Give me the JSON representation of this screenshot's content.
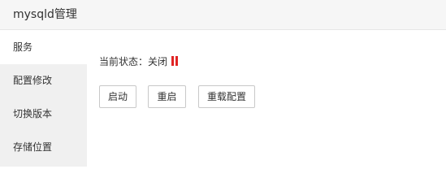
{
  "window": {
    "title": "mysqld管理"
  },
  "sidebar": {
    "items": [
      {
        "label": "服务",
        "active": true
      },
      {
        "label": "配置修改",
        "active": false
      },
      {
        "label": "切换版本",
        "active": false
      },
      {
        "label": "存储位置",
        "active": false
      }
    ]
  },
  "main": {
    "status": {
      "label": "当前状态：",
      "value": "关闭",
      "icon": "pause-icon",
      "icon_color": "#e02424"
    },
    "buttons": {
      "start": "启动",
      "restart": "重启",
      "reload_config": "重载配置"
    }
  }
}
